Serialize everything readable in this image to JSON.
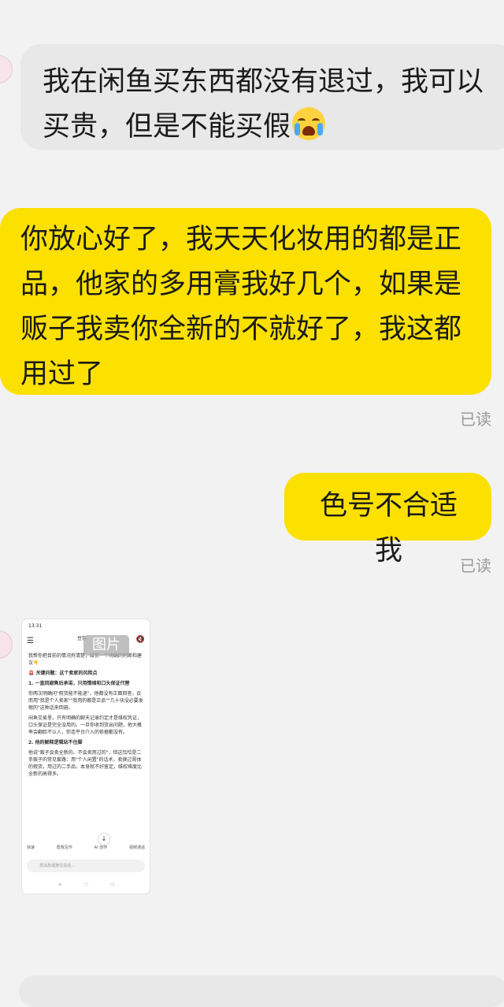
{
  "messages": [
    {
      "side": "in",
      "text": "我在闲鱼买东西都没有退过，我可以买贵，但是不能买假",
      "emoji": "crying-face"
    },
    {
      "side": "out",
      "text": "你放心好了，我天天化妆用的都是正品，他家的多用膏我好几个，如果是贩子我卖你全新的不就好了，我这都用过了",
      "status": "已读"
    },
    {
      "side": "out",
      "text": "色号不合适我",
      "status": "已读"
    }
  ],
  "image_message": {
    "tag": "图片",
    "screenshot": {
      "time": "13:31",
      "title": "豆包",
      "lines": [
        "我帮你把目前的情况捋清楚，给你一个明确的判断和建议👇",
        "🚨 关键问题：这个卖家的风险点",
        "1. 一直回避售后承诺，只用情绪和口头保证代替",
        "你两次明确问\"假货能不能退\"，他都没有正面回答，反而用\"我是个人卖家\"\"我用的都是正品\"\"几十块没必要发假的\"这种话来回避。",
        "闲鱼交易里，只有明确的聊天记录约定才是维权凭证，口头保证是完全没用的。一旦你收到货出问题，他大概率会翻脸不认人，你连平台介入的依据都没有。",
        "2. 他的解释逻辑站不住脚",
        "他说\"贩子会卖全新的、不会卖用过的\"，但这恰恰是二手贩子的常见套路：用\"个人闲置\"的话术，卖换过膏体的假货。用过的二手品，本身就不好鉴定，维权难度比全新的高得多。"
      ],
      "tools": [
        "快速",
        "帮我写作",
        "AI 创作",
        "视频通话"
      ],
      "input_placeholder": "发消息或按住说话..."
    }
  }
}
